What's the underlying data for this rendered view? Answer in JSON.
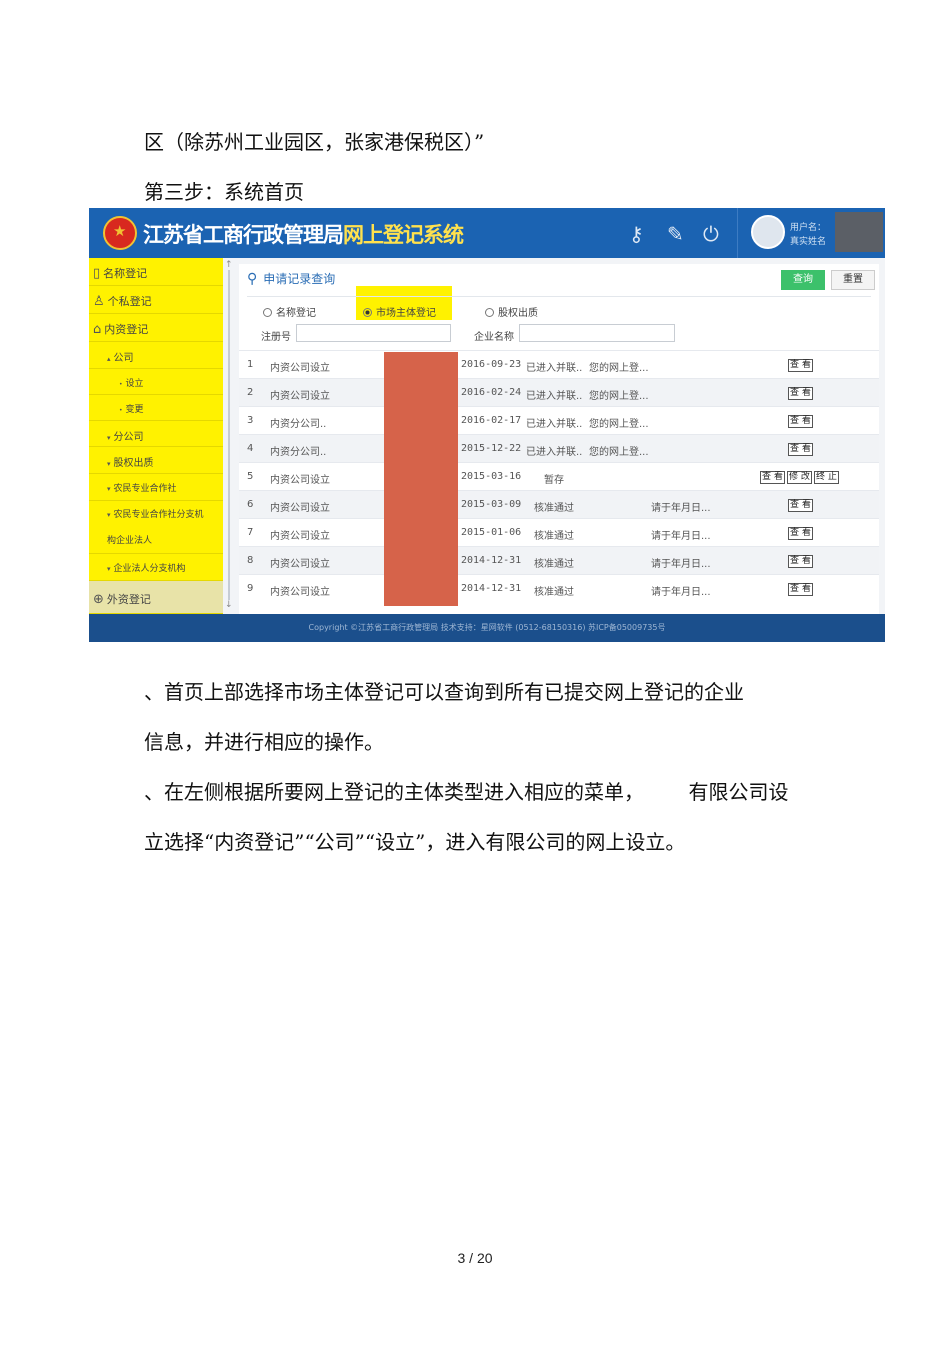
{
  "doc": {
    "line1": "区（除苏州工业园区，张家港保税区）”",
    "line2": "第三步：系统首页",
    "para1a": "、首页上部选择市场主体登记可以查询到所有已提交网上登记的企业",
    "para1b": "信息，并进行相应的操作。",
    "para2a": "、在左侧根据所要网上登记的主体类型进入相应的菜单，       有限公司设",
    "para2b": "立选择“内资登记”“公司”“设立”，进入有限公司的网上设立。",
    "page": "3 / 20"
  },
  "app": {
    "title_main": "江苏省工商行政管理局",
    "title_sub": "网上登记系统",
    "icons": [
      "key-icon",
      "user-edit-icon",
      "power-icon"
    ],
    "user_label": "用户名：",
    "user_name": "真实姓名",
    "footer": "Copyright ©江苏省工商行政管理局    技术支持：星网软件 (0512-68150316)    苏ICP备05009735号",
    "colors": {
      "header": "#1b63b2",
      "highlight": "#fff200",
      "query": "#3cc16b",
      "redact": "#d6634a"
    }
  },
  "sidebar": {
    "items": [
      {
        "label": "名称登记",
        "icon": "document-icon"
      },
      {
        "label": "个私登记",
        "icon": "person-icon"
      },
      {
        "label": "内资登记",
        "icon": "building-icon"
      },
      {
        "label": "公司",
        "icon": "caret-up-icon"
      },
      {
        "label": "设立",
        "icon": "dot-icon"
      },
      {
        "label": "变更",
        "icon": "dot-icon"
      },
      {
        "label": "分公司",
        "icon": "caret-down-icon"
      },
      {
        "label": "股权出质",
        "icon": "caret-down-icon"
      },
      {
        "label": "农民专业合作社",
        "icon": "caret-down-icon"
      },
      {
        "label": "农民专业合作社分支机",
        "icon": "caret-down-icon"
      },
      {
        "label": "构企业法人",
        "icon": ""
      },
      {
        "label": "企业法人分支机构",
        "icon": "caret-down-icon"
      },
      {
        "label": "外资登记",
        "icon": "globe-icon"
      }
    ]
  },
  "panel": {
    "search_title": "申请记录查询",
    "btn_query": "查询",
    "btn_reset": "重置",
    "radios": [
      "名称登记",
      "市场主体登记",
      "股权出质"
    ],
    "reg_no_label": "注册号",
    "company_label": "企业名称",
    "rows": [
      {
        "idx": "1",
        "type": "内资公司设立",
        "date": "2016-09-23",
        "status": "已进入并联..",
        "note": "您的网上登...",
        "actions": [
          "查 看"
        ]
      },
      {
        "idx": "2",
        "type": "内资公司设立",
        "date": "2016-02-24",
        "status": "已进入并联..",
        "note": "您的网上登...",
        "actions": [
          "查 看"
        ]
      },
      {
        "idx": "3",
        "type": "内资分公司..",
        "date": "2016-02-17",
        "status": "已进入并联..",
        "note": "您的网上登...",
        "actions": [
          "查 看"
        ]
      },
      {
        "idx": "4",
        "type": "内资分公司..",
        "date": "2015-12-22",
        "status": "已进入并联..",
        "note": "您的网上登...",
        "actions": [
          "查 看"
        ]
      },
      {
        "idx": "5",
        "type": "内资公司设立",
        "date": "2015-03-16",
        "status": "暂存",
        "note": "",
        "actions": [
          "查 看",
          "修 改",
          "终 止"
        ]
      },
      {
        "idx": "6",
        "type": "内资公司设立",
        "date": "2015-03-09",
        "status": "核准通过",
        "note": "请于年月日...",
        "actions": [
          "查 看"
        ]
      },
      {
        "idx": "7",
        "type": "内资公司设立",
        "date": "2015-01-06",
        "status": "核准通过",
        "note": "请于年月日...",
        "actions": [
          "查 看"
        ]
      },
      {
        "idx": "8",
        "type": "内资公司设立",
        "date": "2014-12-31",
        "status": "核准通过",
        "note": "请于年月日...",
        "actions": [
          "查 看"
        ]
      },
      {
        "idx": "9",
        "type": "内资公司设立",
        "date": "2014-12-31",
        "status": "核准通过",
        "note": "请于年月日...",
        "actions": [
          "查 看"
        ]
      }
    ]
  }
}
